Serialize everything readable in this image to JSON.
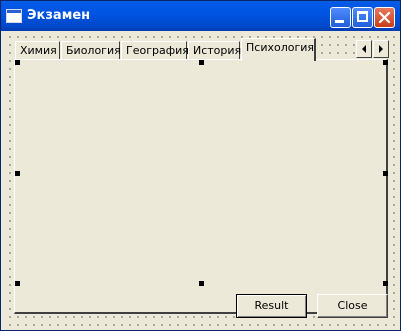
{
  "window": {
    "title": "Экзамен",
    "icons": [
      "app-icon",
      "minimize-icon",
      "maximize-icon",
      "close-icon"
    ]
  },
  "tabs": [
    {
      "label": "Химия",
      "active": false
    },
    {
      "label": "Биология",
      "active": false
    },
    {
      "label": "География",
      "active": false
    },
    {
      "label": "История",
      "active": false
    },
    {
      "label": "Психология",
      "active": true
    }
  ],
  "tab_scroll": {
    "left_icon": "arrow-left-icon",
    "right_icon": "arrow-right-icon"
  },
  "buttons": {
    "result_label": "Result",
    "close_label": "Close"
  },
  "colors": {
    "titlebar": "#0054e3",
    "face": "#ece9d8",
    "close_button": "#c93d19"
  }
}
